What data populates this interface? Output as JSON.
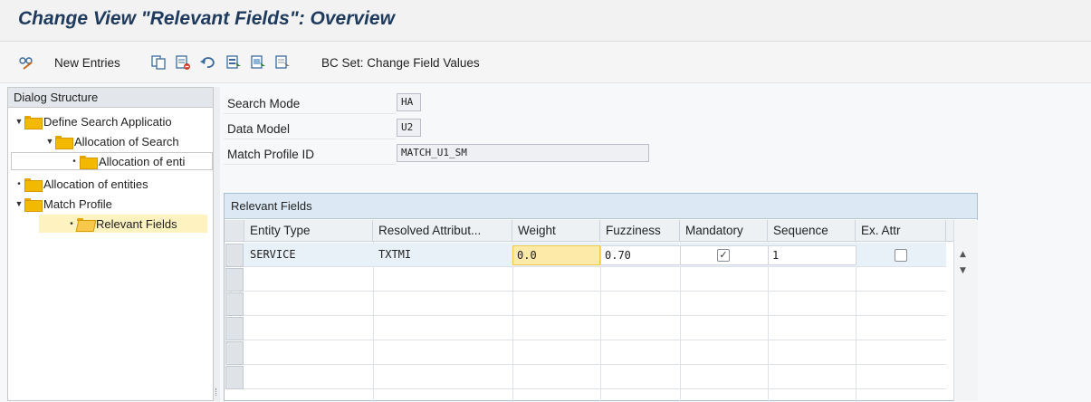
{
  "window": {
    "title": "Change View \"Relevant Fields\": Overview"
  },
  "toolbar": {
    "new_entries_label": "New Entries",
    "bc_set_label": "BC Set: Change Field Values",
    "icons": [
      "glasses-edit-icon",
      "copy-icon",
      "delete-icon",
      "undo-icon",
      "select-all-icon",
      "select-block-icon",
      "deselect-all-icon"
    ]
  },
  "dialog_structure": {
    "header": "Dialog Structure",
    "items": [
      {
        "label": "Define Search Applicatio",
        "level": 0,
        "expanded": true
      },
      {
        "label": "Allocation of Search",
        "level": 1,
        "expanded": true
      },
      {
        "label": "Allocation of enti",
        "level": 2,
        "expanded": false
      },
      {
        "label": "Allocation of entities",
        "level": 0,
        "expanded": false
      },
      {
        "label": "Match Profile",
        "level": 0,
        "expanded": true
      },
      {
        "label": "Relevant Fields",
        "level": 1,
        "expanded": false,
        "selected": true
      }
    ]
  },
  "header_fields": {
    "search_mode": {
      "label": "Search Mode",
      "value": "HA"
    },
    "data_model": {
      "label": "Data Model",
      "value": "U2"
    },
    "match_profile": {
      "label": "Match Profile ID",
      "value": "MATCH_U1_SM"
    }
  },
  "table": {
    "title": "Relevant Fields",
    "columns": [
      "Entity Type",
      "Resolved Attribut...",
      "Weight",
      "Fuzziness",
      "Mandatory",
      "Sequence",
      "Ex. Attr"
    ],
    "rows": [
      {
        "entity_type": "SERVICE",
        "resolved_attribute": "TXTMI",
        "weight": "0.0",
        "fuzziness": "0.70",
        "mandatory": true,
        "sequence": "1",
        "ex_attr": false
      }
    ],
    "empty_rows": 6
  },
  "colors": {
    "title": "#1e3a5c",
    "table_header": "#dce9f5",
    "focus_cell": "#fde9a8",
    "folder": "#f3b800"
  }
}
